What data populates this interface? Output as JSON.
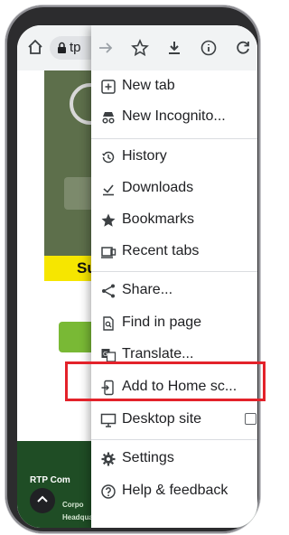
{
  "toolbar": {
    "url": "tp"
  },
  "page": {
    "yellow_bar_text": "Su",
    "footer_company": "RTP Com",
    "footer_corp": "Corpo",
    "footer_hq": "Headquarters"
  },
  "menu": {
    "items": [
      {
        "label": "New tab",
        "icon": "plus-box-icon"
      },
      {
        "label": "New Incognito...",
        "icon": "incognito-icon"
      },
      {
        "label": "History",
        "icon": "history-icon"
      },
      {
        "label": "Downloads",
        "icon": "downloads-icon"
      },
      {
        "label": "Bookmarks",
        "icon": "star-icon"
      },
      {
        "label": "Recent tabs",
        "icon": "recent-tabs-icon"
      },
      {
        "label": "Share...",
        "icon": "share-icon"
      },
      {
        "label": "Find in page",
        "icon": "find-icon"
      },
      {
        "label": "Translate...",
        "icon": "translate-icon"
      },
      {
        "label": "Add to Home sc...",
        "icon": "add-home-icon"
      },
      {
        "label": "Desktop site",
        "icon": "desktop-icon",
        "checked": false
      },
      {
        "label": "Settings",
        "icon": "gear-icon"
      },
      {
        "label": "Help & feedback",
        "icon": "help-icon"
      }
    ]
  },
  "colors": {
    "highlight": "#e3222a",
    "toolbar": "#f1f3f4"
  }
}
